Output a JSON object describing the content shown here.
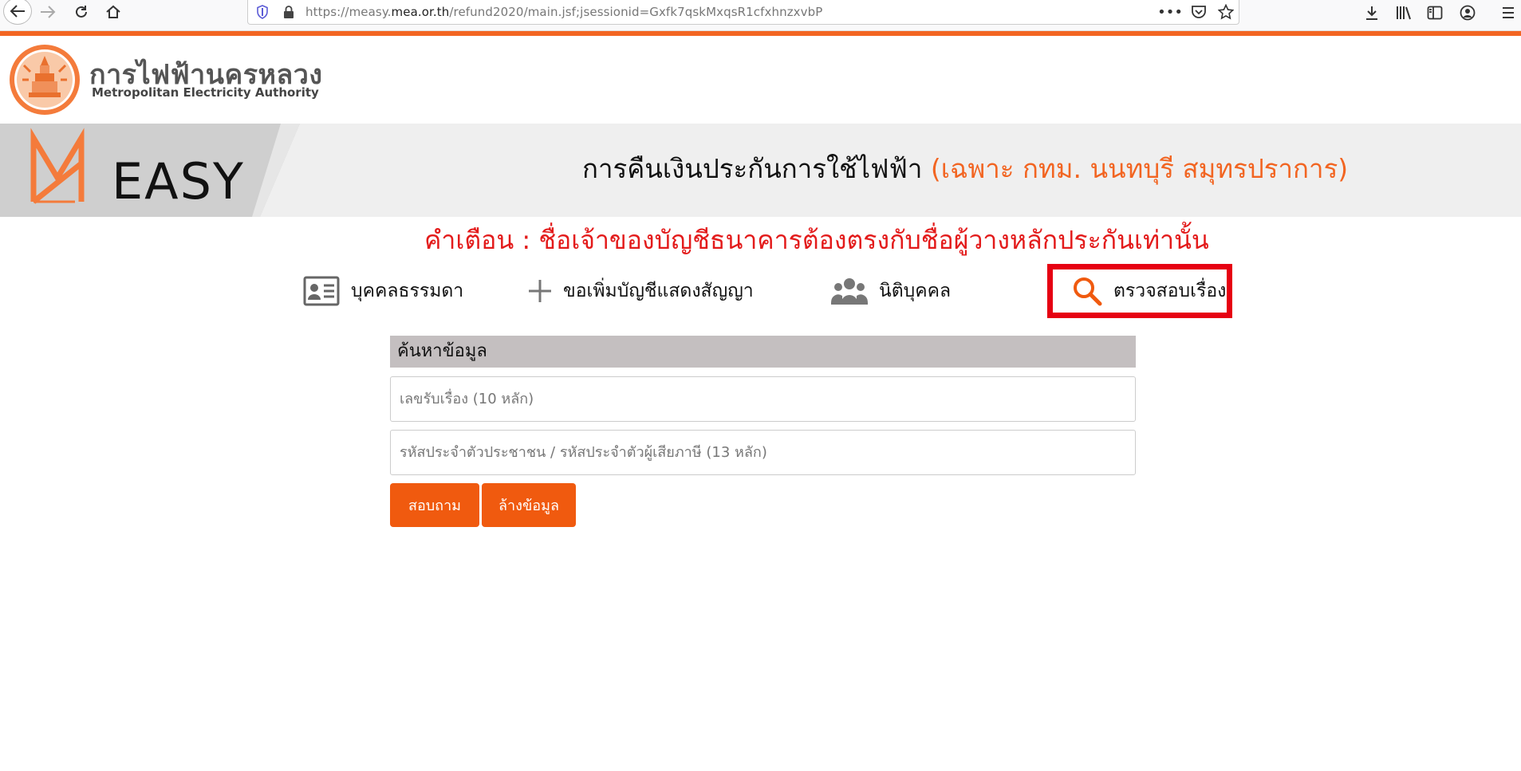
{
  "browser": {
    "url_prefix": "https://measy.",
    "url_domain": "mea.or.th",
    "url_path": "/refund2020/main.jsf;jsessionid=Gxfk7qskMxqsR1cfxhnzxvbP"
  },
  "header": {
    "org_name_th": "การไฟฟ้านครหลวง",
    "org_name_en": "Metropolitan Electricity Authority"
  },
  "banner": {
    "logo_text": "EASY",
    "title": "การคืนเงินประกันการใช้ไฟฟ้า",
    "title_scope": "(เฉพาะ กทม. นนทบุรี สมุทรปราการ)"
  },
  "warning": "คำเตือน : ชื่อเจ้าของบัญชีธนาคารต้องตรงกับชื่อผู้วางหลักประกันเท่านั้น",
  "menu": {
    "items": [
      {
        "label": "บุคคลธรรมดา",
        "icon": "id-card-icon"
      },
      {
        "label": "ขอเพิ่มบัญชีแสดงสัญญา",
        "icon": "plus-icon"
      },
      {
        "label": "นิติบุคคล",
        "icon": "users-icon"
      },
      {
        "label": "ตรวจสอบเรื่อง",
        "icon": "search-icon"
      }
    ]
  },
  "search": {
    "heading": "ค้นหาข้อมูล",
    "case_placeholder": "เลขรับเรื่อง (10 หลัก)",
    "id_placeholder": "รหัสประจำตัวประชาชน / รหัสประจำตัวผู้เสียภาษี (13 หลัก)",
    "ask_label": "สอบถาม",
    "clear_label": "ล้างข้อมูล"
  },
  "colors": {
    "brand_orange": "#f26522",
    "warning_red": "#e31b1b",
    "highlight_red": "#e60012"
  }
}
